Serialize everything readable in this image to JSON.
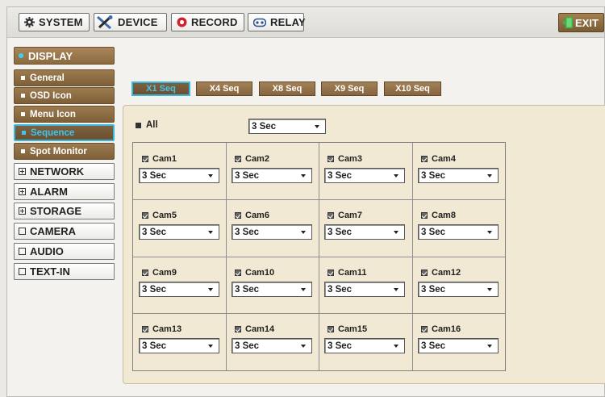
{
  "topbar": {
    "buttons": [
      {
        "label": "SYSTEM",
        "icon": "gear-icon"
      },
      {
        "label": "DEVICE",
        "icon": "tools-icon"
      },
      {
        "label": "RECORD",
        "icon": "record-icon"
      },
      {
        "label": "RELAY",
        "icon": "relay-icon"
      }
    ],
    "exit_label": "EXIT",
    "exit_icon": "exit-door-icon"
  },
  "sidebar": {
    "display_label": "DISPLAY",
    "display_items": [
      "General",
      "OSD Icon",
      "Menu Icon",
      "Sequence",
      "Spot Monitor"
    ],
    "active_item": "Sequence",
    "groups": [
      {
        "label": "NETWORK",
        "expandable": true
      },
      {
        "label": "ALARM",
        "expandable": true
      },
      {
        "label": "STORAGE",
        "expandable": true
      },
      {
        "label": "CAMERA",
        "expandable": false
      },
      {
        "label": "AUDIO",
        "expandable": false
      },
      {
        "label": "TEXT-IN",
        "expandable": false
      }
    ]
  },
  "tabs": [
    "X1 Seq",
    "X4 Seq",
    "X8 Seq",
    "X9 Seq",
    "X10 Seq"
  ],
  "active_tab": "X1 Seq",
  "all_label": "All",
  "all_value": "3 Sec",
  "cameras": [
    {
      "name": "Cam1",
      "value": "3 Sec"
    },
    {
      "name": "Cam2",
      "value": "3 Sec"
    },
    {
      "name": "Cam3",
      "value": "3 Sec"
    },
    {
      "name": "Cam4",
      "value": "3 Sec"
    },
    {
      "name": "Cam5",
      "value": "3 Sec"
    },
    {
      "name": "Cam6",
      "value": "3 Sec"
    },
    {
      "name": "Cam7",
      "value": "3 Sec"
    },
    {
      "name": "Cam8",
      "value": "3 Sec"
    },
    {
      "name": "Cam9",
      "value": "3 Sec"
    },
    {
      "name": "Cam10",
      "value": "3 Sec"
    },
    {
      "name": "Cam11",
      "value": "3 Sec"
    },
    {
      "name": "Cam12",
      "value": "3 Sec"
    },
    {
      "name": "Cam13",
      "value": "3 Sec"
    },
    {
      "name": "Cam14",
      "value": "3 Sec"
    },
    {
      "name": "Cam15",
      "value": "3 Sec"
    },
    {
      "name": "Cam16",
      "value": "3 Sec"
    }
  ],
  "colors": {
    "menu_brown": "#8b6a40",
    "active_cyan": "#37b8e0",
    "panel_bg": "#f1e9d3",
    "exit_green": "#38b54a",
    "record_red": "#d0202a"
  }
}
